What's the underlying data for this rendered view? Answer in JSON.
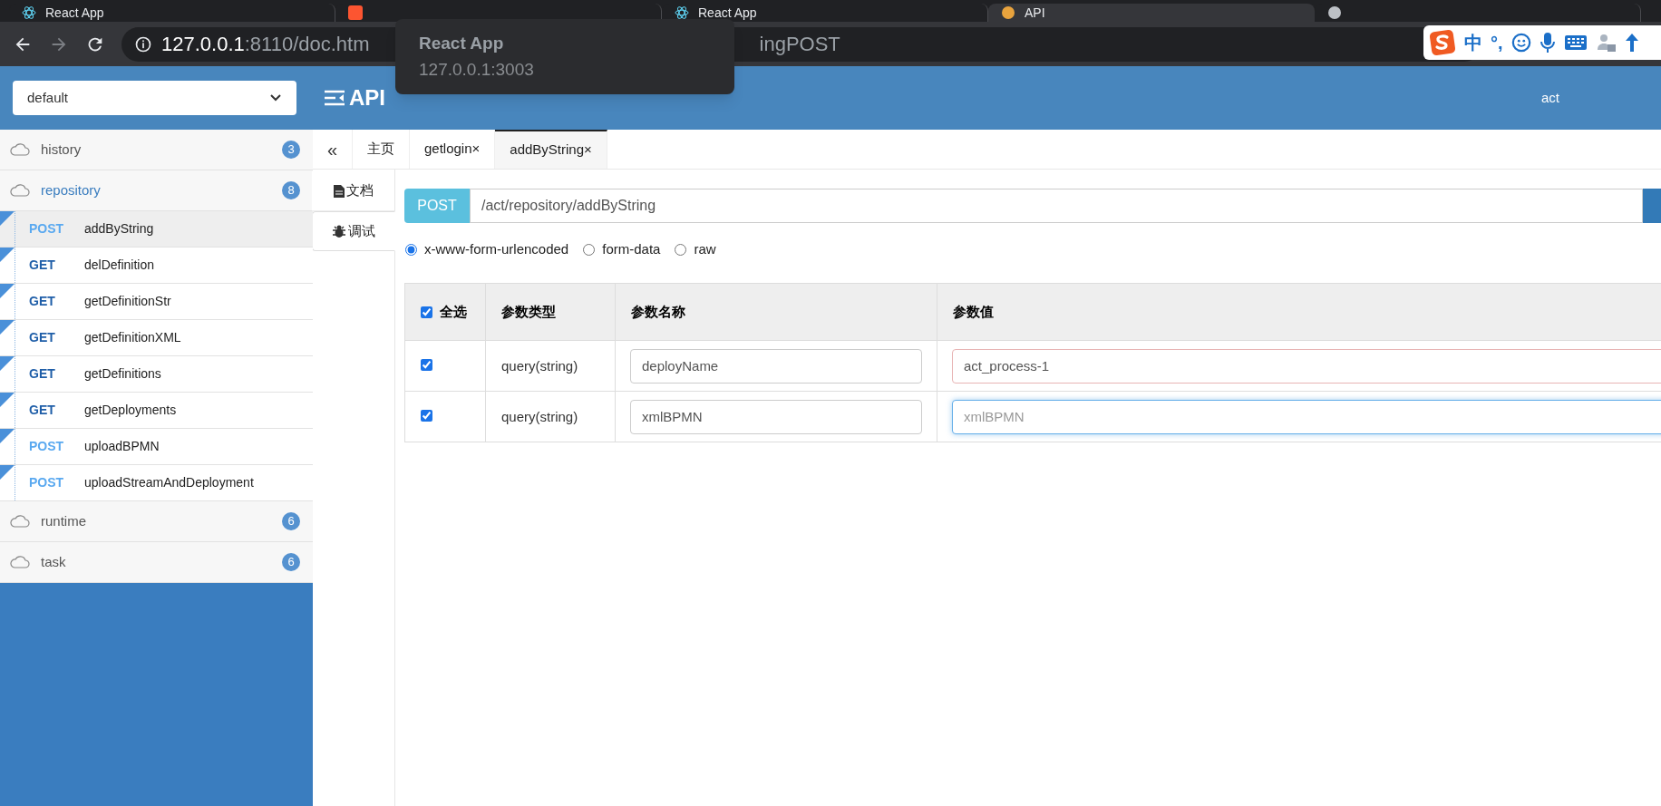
{
  "browser": {
    "tabs": [
      {
        "title": "React App",
        "kind": "react",
        "selected": false
      },
      {
        "kind": "csdn",
        "selected": false
      },
      {
        "title": "React App",
        "kind": "react",
        "selected": false
      },
      {
        "title": "API",
        "kind": "api",
        "selected": true
      },
      {
        "kind": "blank",
        "selected": false
      }
    ],
    "address": {
      "host": "127.0.0.1",
      "rest": ":8110/doc.htm",
      "tail": "ingPOST"
    },
    "tooltip": {
      "title": "React App",
      "url": "127.0.0.1:3003"
    },
    "ime": {
      "labels": [
        "中",
        "°,"
      ]
    }
  },
  "header": {
    "select": "default",
    "title": "API",
    "user": "act"
  },
  "sidebar": {
    "groups": [
      {
        "name": "history",
        "count": "3",
        "expanded": false
      },
      {
        "name": "repository",
        "count": "8",
        "expanded": true,
        "items": [
          {
            "method": "POST",
            "color": "#5aa9f0",
            "name": "addByString",
            "selected": true
          },
          {
            "method": "GET",
            "color": "#1f5ea8",
            "name": "delDefinition",
            "selected": false
          },
          {
            "method": "GET",
            "color": "#1f5ea8",
            "name": "getDefinitionStr",
            "selected": false
          },
          {
            "method": "GET",
            "color": "#1f5ea8",
            "name": "getDefinitionXML",
            "selected": false
          },
          {
            "method": "GET",
            "color": "#1f5ea8",
            "name": "getDefinitions",
            "selected": false
          },
          {
            "method": "GET",
            "color": "#1f5ea8",
            "name": "getDeployments",
            "selected": false
          },
          {
            "method": "POST",
            "color": "#5aa9f0",
            "name": "uploadBPMN",
            "selected": false
          },
          {
            "method": "POST",
            "color": "#5aa9f0",
            "name": "uploadStreamAndDeployment",
            "selected": false
          }
        ]
      },
      {
        "name": "runtime",
        "count": "6",
        "expanded": false
      },
      {
        "name": "task",
        "count": "6",
        "expanded": false
      }
    ]
  },
  "content": {
    "collapse": "«",
    "tabs": [
      {
        "label": "主页",
        "selected": false
      },
      {
        "label": "getlogin",
        "close": "×",
        "selected": false
      },
      {
        "label": "addByString",
        "close": "×",
        "selected": true
      }
    ],
    "side_tabs": [
      {
        "label": "文档",
        "kind": "doc",
        "selected": false
      },
      {
        "label": "调试",
        "kind": "debug",
        "selected": true
      }
    ],
    "request": {
      "method": "POST",
      "path": "/act/repository/addByString"
    },
    "body_types": [
      {
        "label": "x-www-form-urlencoded",
        "selected": true
      },
      {
        "label": "form-data",
        "selected": false
      },
      {
        "label": "raw",
        "selected": false
      }
    ],
    "table": {
      "select_all": {
        "label": "全选",
        "checked": true
      },
      "columns": [
        "参数类型",
        "参数名称",
        "参数值"
      ],
      "rows": [
        {
          "checked": true,
          "type": "query(string)",
          "name": "deployName",
          "value": {
            "value": "act_process-1",
            "invalid": true,
            "focused": false
          }
        },
        {
          "checked": true,
          "type": "query(string)",
          "name": "xmlBPMN",
          "value": {
            "placeholder": "xmlBPMN",
            "focused": true
          }
        }
      ]
    }
  }
}
